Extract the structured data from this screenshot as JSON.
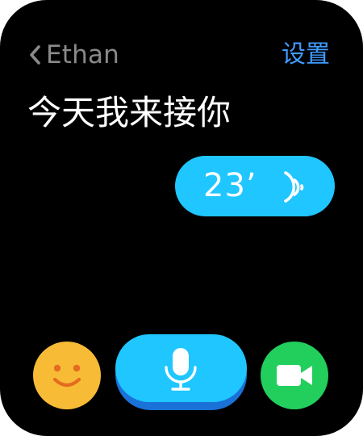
{
  "header": {
    "contact_name": "Ethan",
    "back_icon": "chevron-left-icon",
    "settings_label": "设置"
  },
  "conversation": {
    "message_text": "今天我来接你",
    "voice_message": {
      "duration": "23’",
      "icon": "sound-wave-icon"
    }
  },
  "toolbar": {
    "emoji_icon": "smiley-face-icon",
    "mic_icon": "microphone-icon",
    "video_icon": "video-camera-icon"
  },
  "colors": {
    "background": "#000000",
    "accent_blue": "#1fc6ff",
    "link_blue": "#3f9cff",
    "emoji_yellow": "#f8bb36",
    "video_green": "#22cf5d",
    "muted_text": "#8a8a8a"
  }
}
